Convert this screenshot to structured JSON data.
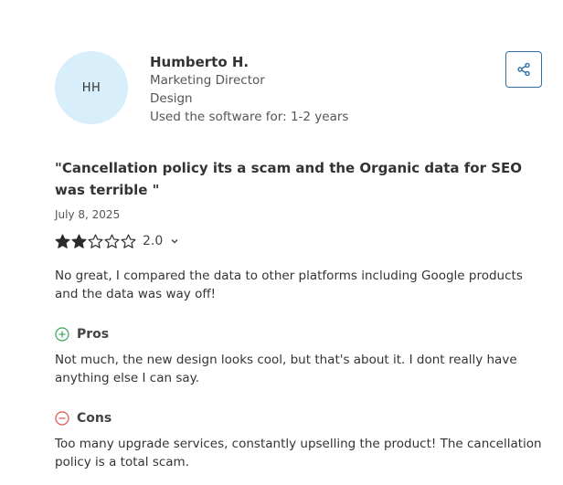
{
  "reviewer": {
    "initials": "HH",
    "name": "Humberto H.",
    "role": "Marketing Director",
    "industry": "Design",
    "usage": "Used the software for: 1-2 years"
  },
  "share": {
    "icon": "share-icon"
  },
  "review": {
    "title": "\"Cancellation policy its a scam and the Organic data for SEO was terrible \"",
    "date": "July 8, 2025",
    "rating": {
      "value": "2.0",
      "filled_stars": 2,
      "max_stars": 5
    },
    "summary": "No great, I compared the data to other platforms including Google products and the data was way off!",
    "pros": {
      "label": "Pros",
      "text": "Not much, the new design looks cool, but that's about it. I dont really have anything else I can say."
    },
    "cons": {
      "label": "Cons",
      "text": "Too many upgrade services, constantly upselling the product! The cancellation policy is a total scam."
    }
  },
  "colors": {
    "avatar_bg": "#d9eefb",
    "accent": "#2f6fa7",
    "pros_green": "#3aa55d",
    "cons_red": "#d9534f",
    "star": "#2b2b2b"
  }
}
